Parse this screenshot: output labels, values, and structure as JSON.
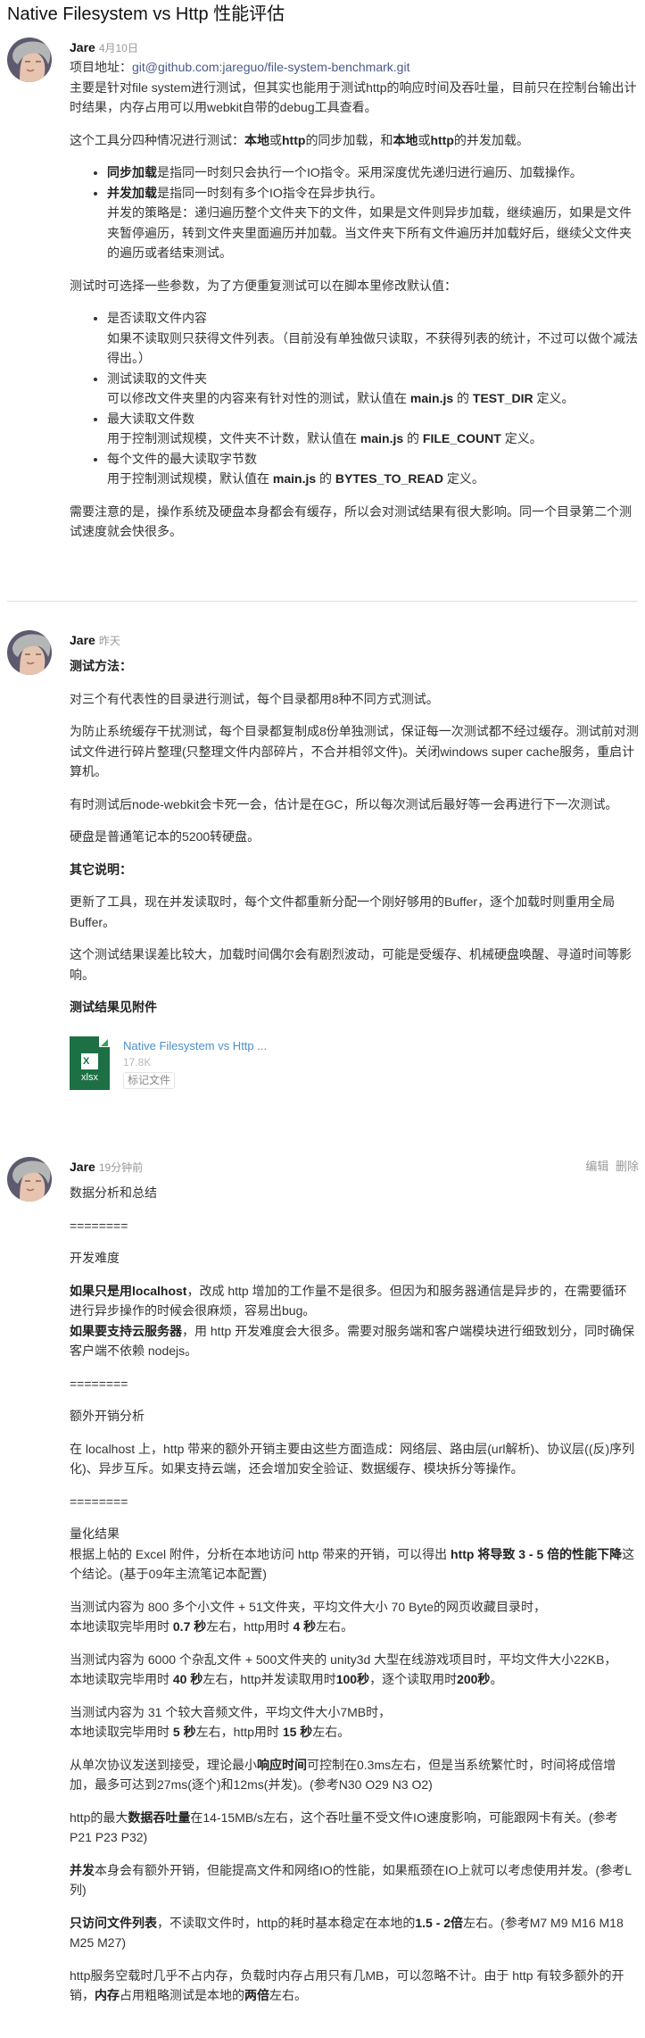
{
  "page": {
    "title": "Native Filesystem vs Http 性能评估"
  },
  "comments": [
    {
      "author": "Jare",
      "time": "4月10日",
      "blocks": [
        {
          "type": "p",
          "lines": [
            [
              {
                "t": "项目地址："
              },
              {
                "t": "git@github.com:jareguo/file-system-benchmark.git",
                "link": true
              }
            ],
            [
              {
                "t": "主要是针对file system进行测试，但其实也能用于测试http的响应时间及吞吐量，目前只在控制台输出计时结果，内存占用可以用webkit自带的debug工具查看。"
              }
            ]
          ]
        },
        {
          "type": "p",
          "lines": [
            [
              {
                "t": "这个工具分四种情况进行测试："
              },
              {
                "t": "本地",
                "b": true
              },
              {
                "t": "或"
              },
              {
                "t": "http",
                "b": true
              },
              {
                "t": "的同步加载，和"
              },
              {
                "t": "本地",
                "b": true
              },
              {
                "t": "或"
              },
              {
                "t": "http",
                "b": true
              },
              {
                "t": "的并发加载。"
              }
            ]
          ]
        },
        {
          "type": "ul",
          "items": [
            {
              "lines": [
                [
                  {
                    "t": "同步加载",
                    "b": true
                  },
                  {
                    "t": "是指同一时刻只会执行一个IO指令。采用深度优先递归进行遍历、加载操作。"
                  }
                ]
              ]
            },
            {
              "lines": [
                [
                  {
                    "t": "并发加载",
                    "b": true
                  },
                  {
                    "t": "是指同一时刻有多个IO指令在异步执行。"
                  }
                ],
                [
                  {
                    "t": "并发的策略是：递归遍历整个文件夹下的文件，如果是文件则异步加载，继续遍历，如果是文件夹暂停遍历，转到文件夹里面遍历并加载。当文件夹下所有文件遍历并加载好后，继续父文件夹的遍历或者结束测试。"
                  }
                ]
              ]
            }
          ]
        },
        {
          "type": "p",
          "lines": [
            [
              {
                "t": "测试时可选择一些参数，为了方便重复测试可以在脚本里修改默认值："
              }
            ]
          ]
        },
        {
          "type": "ul",
          "items": [
            {
              "lines": [
                [
                  {
                    "t": "是否读取文件内容"
                  }
                ],
                [
                  {
                    "t": "如果不读取则只获得文件列表。（目前没有单独做只读取，不获得列表的统计，不过可以做个减法得出。）"
                  }
                ]
              ]
            },
            {
              "lines": [
                [
                  {
                    "t": "测试读取的文件夹"
                  }
                ],
                [
                  {
                    "t": "可以修改文件夹里的内容来有针对性的测试，默认值在 "
                  },
                  {
                    "t": "main.js",
                    "b": true
                  },
                  {
                    "t": " 的 "
                  },
                  {
                    "t": "TEST_DIR",
                    "b": true
                  },
                  {
                    "t": " 定义。"
                  }
                ]
              ]
            },
            {
              "lines": [
                [
                  {
                    "t": "最大读取文件数"
                  }
                ],
                [
                  {
                    "t": "用于控制测试规模，文件夹不计数，默认值在 "
                  },
                  {
                    "t": "main.js",
                    "b": true
                  },
                  {
                    "t": " 的 "
                  },
                  {
                    "t": "FILE_COUNT",
                    "b": true
                  },
                  {
                    "t": " 定义。"
                  }
                ]
              ]
            },
            {
              "lines": [
                [
                  {
                    "t": "每个文件的最大读取字节数"
                  }
                ],
                [
                  {
                    "t": "用于控制测试规模，默认值在 "
                  },
                  {
                    "t": "main.js",
                    "b": true
                  },
                  {
                    "t": " 的 "
                  },
                  {
                    "t": "BYTES_TO_READ",
                    "b": true
                  },
                  {
                    "t": " 定义。"
                  }
                ]
              ]
            }
          ]
        },
        {
          "type": "p",
          "lines": [
            [
              {
                "t": "需要注意的是，操作系统及硬盘本身都会有缓存，所以会对测试结果有很大影响。同一个目录第二个测试速度就会快很多。"
              }
            ]
          ]
        }
      ]
    },
    {
      "author": "Jare",
      "time": "昨天",
      "blocks": [
        {
          "type": "p",
          "lines": [
            [
              {
                "t": "测试方法：",
                "b": true
              }
            ]
          ]
        },
        {
          "type": "p",
          "lines": [
            [
              {
                "t": "对三个有代表性的目录进行测试，每个目录都用8种不同方式测试。"
              }
            ]
          ]
        },
        {
          "type": "p",
          "lines": [
            [
              {
                "t": "为防止系统缓存干扰测试，每个目录都复制成8份单独测试，保证每一次测试都不经过缓存。测试前对测试文件进行碎片整理(只整理文件内部碎片，不合并相邻文件)。关闭windows super cache服务，重启计算机。"
              }
            ]
          ]
        },
        {
          "type": "p",
          "lines": [
            [
              {
                "t": "有时测试后node-webkit会卡死一会，估计是在GC，所以每次测试后最好等一会再进行下一次测试。"
              }
            ]
          ]
        },
        {
          "type": "p",
          "lines": [
            [
              {
                "t": "硬盘是普通笔记本的5200转硬盘。"
              }
            ]
          ]
        },
        {
          "type": "p",
          "lines": [
            [
              {
                "t": "其它说明：",
                "b": true
              }
            ]
          ]
        },
        {
          "type": "p",
          "lines": [
            [
              {
                "t": "更新了工具，现在并发读取时，每个文件都重新分配一个刚好够用的Buffer，逐个加载时则重用全局Buffer。"
              }
            ]
          ]
        },
        {
          "type": "p",
          "lines": [
            [
              {
                "t": "这个测试结果误差比较大，加载时间偶尔会有剧烈波动，可能是受缓存、机械硬盘唤醒、寻道时间等影响。"
              }
            ]
          ]
        },
        {
          "type": "p",
          "lines": [
            [
              {
                "t": "测试结果见附件",
                "b": true
              }
            ]
          ]
        }
      ],
      "attachment": {
        "icon_letter": "X",
        "ext": "xlsx",
        "name": "Native Filesystem vs Http ...",
        "size": "17.8K",
        "tag_button": "标记文件",
        "brand_color": "#1d7044"
      }
    },
    {
      "author": "Jare",
      "time": "19分钟前",
      "actions": {
        "edit": "编辑",
        "delete": "删除"
      },
      "blocks": [
        {
          "type": "p",
          "lines": [
            [
              {
                "t": "数据分析和总结"
              }
            ]
          ]
        },
        {
          "type": "p",
          "lines": [
            [
              {
                "t": "========"
              }
            ]
          ]
        },
        {
          "type": "p",
          "lines": [
            [
              {
                "t": "开发难度"
              }
            ]
          ]
        },
        {
          "type": "p",
          "lines": [
            [
              {
                "t": "如果只是用localhost",
                "b": true
              },
              {
                "t": "，改成 http 增加的工作量不是很多。但因为和服务器通信是异步的，在需要循环进行异步操作的时候会很麻烦，容易出bug。"
              }
            ],
            [
              {
                "t": "如果要支持云服务器",
                "b": true
              },
              {
                "t": "，用 http 开发难度会大很多。需要对服务端和客户端模块进行细致划分，同时确保客户端不依赖 nodejs。"
              }
            ]
          ]
        },
        {
          "type": "p",
          "lines": [
            [
              {
                "t": "========"
              }
            ]
          ]
        },
        {
          "type": "p",
          "lines": [
            [
              {
                "t": "额外开销分析"
              }
            ]
          ]
        },
        {
          "type": "p",
          "lines": [
            [
              {
                "t": "在 localhost 上，http 带来的额外开销主要由这些方面造成：网络层、路由层(url解析)、协议层((反)序列化)、异步互斥。如果支持云端，还会增加安全验证、数据缓存、模块拆分等操作。"
              }
            ]
          ]
        },
        {
          "type": "p",
          "lines": [
            [
              {
                "t": "========"
              }
            ]
          ]
        },
        {
          "type": "p",
          "lines": [
            [
              {
                "t": "量化结果"
              }
            ],
            [
              {
                "t": "根据上帖的 Excel 附件，分析在本地访问 http 带来的开销，可以得出 "
              },
              {
                "t": "http 将导致 3 - 5 倍的性能下降",
                "b": true
              },
              {
                "t": "这个结论。(基于09年主流笔记本配置)"
              }
            ]
          ]
        },
        {
          "type": "p",
          "lines": [
            [
              {
                "t": "当测试内容为 800 多个小文件 + 51文件夹，平均文件大小 70 Byte的网页收藏目录时，"
              }
            ],
            [
              {
                "t": "本地读取完毕用时 "
              },
              {
                "t": "0.7 秒",
                "b": true
              },
              {
                "t": "左右，http用时 "
              },
              {
                "t": "4 秒",
                "b": true
              },
              {
                "t": "左右。"
              }
            ]
          ]
        },
        {
          "type": "p",
          "lines": [
            [
              {
                "t": "当测试内容为 6000 个杂乱文件 + 500文件夹的 unity3d 大型在线游戏项目时，平均文件大小22KB，"
              }
            ],
            [
              {
                "t": "本地读取完毕用时 "
              },
              {
                "t": "40 秒",
                "b": true
              },
              {
                "t": "左右，http并发读取用时"
              },
              {
                "t": "100秒",
                "b": true
              },
              {
                "t": "，逐个读取用时"
              },
              {
                "t": "200秒",
                "b": true
              },
              {
                "t": "。"
              }
            ]
          ]
        },
        {
          "type": "p",
          "lines": [
            [
              {
                "t": "当测试内容为 31 个较大音频文件，平均文件大小7MB时，"
              }
            ],
            [
              {
                "t": "本地读取完毕用时 "
              },
              {
                "t": "5 秒",
                "b": true
              },
              {
                "t": "左右，http用时 "
              },
              {
                "t": "15 秒",
                "b": true
              },
              {
                "t": "左右。"
              }
            ]
          ]
        },
        {
          "type": "p",
          "lines": [
            [
              {
                "t": "从单次协议发送到接受，理论最小"
              },
              {
                "t": "响应时间",
                "b": true
              },
              {
                "t": "可控制在0.3ms左右，但是当系统繁忙时，时间将成倍增加，最多可达到27ms(逐个)和12ms(并发)。(参考N30 O29 N3 O2)"
              }
            ]
          ]
        },
        {
          "type": "p",
          "lines": [
            [
              {
                "t": "http的最大"
              },
              {
                "t": "数据吞吐量",
                "b": true
              },
              {
                "t": "在14-15MB/s左右，这个吞吐量不受文件IO速度影响，可能跟网卡有关。(参考P21 P23 P32)"
              }
            ]
          ]
        },
        {
          "type": "p",
          "lines": [
            [
              {
                "t": "并发",
                "b": true
              },
              {
                "t": "本身会有额外开销，但能提高文件和网络IO的性能，如果瓶颈在IO上就可以考虑使用并发。(参考L列)"
              }
            ]
          ]
        },
        {
          "type": "p",
          "lines": [
            [
              {
                "t": "只访问文件列表",
                "b": true
              },
              {
                "t": "，不读取文件时，http的耗时基本稳定在本地的"
              },
              {
                "t": "1.5 - 2倍",
                "b": true
              },
              {
                "t": "左右。(参考M7 M9 M16 M18 M25 M27)"
              }
            ]
          ]
        },
        {
          "type": "p",
          "lines": [
            [
              {
                "t": "http服务空载时几乎不占内存，负载时内存占用只有几MB，可以忽略不计。由于 http 有较多额外的开销，"
              },
              {
                "t": "内存",
                "b": true
              },
              {
                "t": "占用粗略测试是本地的"
              },
              {
                "t": "两倍",
                "b": true
              },
              {
                "t": "左右。"
              }
            ]
          ]
        }
      ]
    }
  ]
}
